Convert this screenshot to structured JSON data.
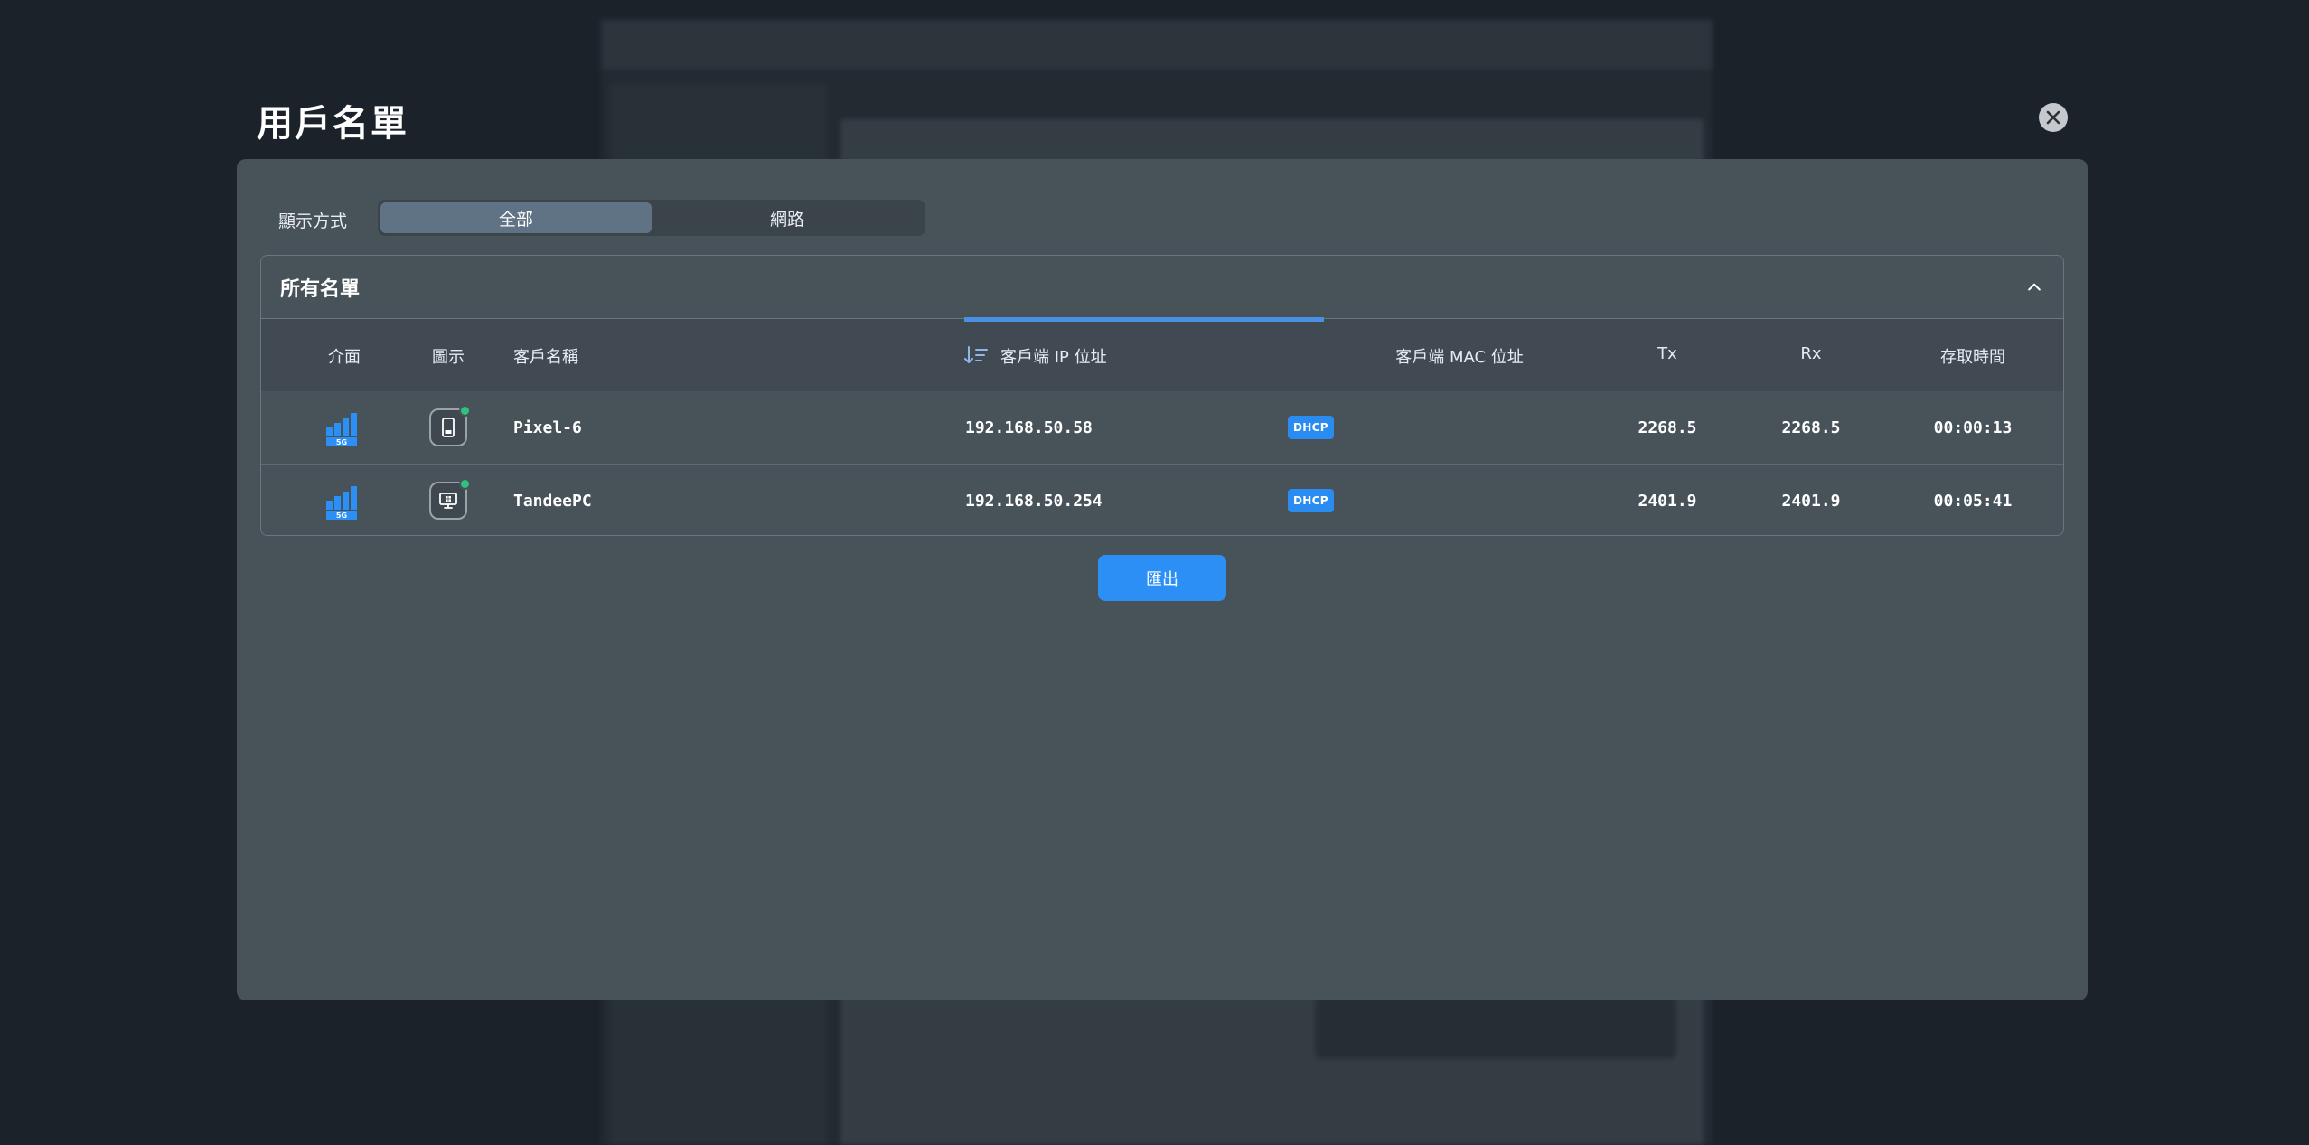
{
  "modal": {
    "title": "用戶名單"
  },
  "view": {
    "label": "顯示方式",
    "options": [
      "全部",
      "網路"
    ],
    "selected": "全部"
  },
  "list": {
    "title": "所有名單",
    "columns": {
      "interface": "介面",
      "icon": "圖示",
      "client_name": "客戶名稱",
      "client_ip": "客戶端 IP 位址",
      "client_mac": "客戶端 MAC 位址",
      "tx": "Tx",
      "rx": "Rx",
      "access_time": "存取時間"
    },
    "sorted_by": "client_ip",
    "rows": [
      {
        "interface": "5G",
        "device_icon": "smartphone-icon",
        "name": "Pixel-6",
        "ip": "192.168.50.58",
        "ip_type": "DHCP",
        "mac": "",
        "tx": "2268.5",
        "rx": "2268.5",
        "access_time": "00:00:13"
      },
      {
        "interface": "5G",
        "device_icon": "windows-pc-icon",
        "name": "TandeePC",
        "ip": "192.168.50.254",
        "ip_type": "DHCP",
        "mac": "",
        "tx": "2401.9",
        "rx": "2401.9",
        "access_time": "00:05:41"
      }
    ]
  },
  "actions": {
    "export_label": "匯出"
  },
  "colors": {
    "accent": "#2b8ff5",
    "online": "#2ec27e",
    "panel": "#485259",
    "backdrop": "#1b222a"
  }
}
